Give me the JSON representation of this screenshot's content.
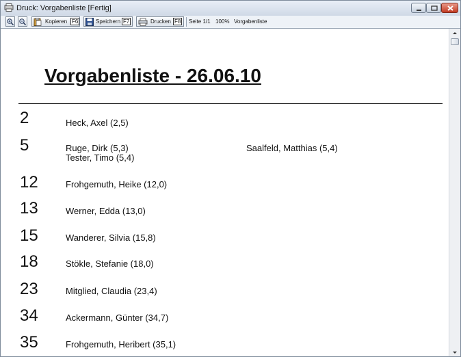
{
  "window": {
    "title": "Druck: Vorgabenliste [Fertig]"
  },
  "toolbar": {
    "copy_label": "Kopieren",
    "copy_key": "F6",
    "save_label": "Speichern",
    "save_key": "F7",
    "print_label": "Drucken",
    "print_key": "F8",
    "page_info": "Seite 1/1",
    "zoom": "100%",
    "doc_name": "Vorgabenliste"
  },
  "document": {
    "title": "Vorgabenliste - 26.06.10",
    "rows": [
      {
        "number": "2",
        "names": [
          "Heck, Axel (2,5)"
        ]
      },
      {
        "number": "5",
        "names": [
          "Ruge, Dirk (5,3)",
          "Tester, Timo (5,4)"
        ],
        "names_col2": [
          "Saalfeld, Matthias (5,4)"
        ]
      },
      {
        "number": "12",
        "names": [
          "Frohgemuth, Heike (12,0)"
        ]
      },
      {
        "number": "13",
        "names": [
          "Werner, Edda (13,0)"
        ]
      },
      {
        "number": "15",
        "names": [
          "Wanderer, Silvia (15,8)"
        ]
      },
      {
        "number": "18",
        "names": [
          "Stökle, Stefanie (18,0)"
        ]
      },
      {
        "number": "23",
        "names": [
          "Mitglied, Claudia (23,4)"
        ]
      },
      {
        "number": "34",
        "names": [
          "Ackermann, Günter (34,7)"
        ]
      },
      {
        "number": "35",
        "names": [
          "Frohgemuth, Heribert (35,1)"
        ]
      }
    ]
  },
  "icons": {
    "app": "printer-window-icon",
    "zoom_in": "zoom-in-icon",
    "zoom_out": "zoom-out-icon",
    "copy": "copy-icon",
    "save": "floppy-disk-icon",
    "print": "printer-icon"
  },
  "colors": {
    "close_button": "#c23a22",
    "titlebar": "#dce4ee"
  }
}
